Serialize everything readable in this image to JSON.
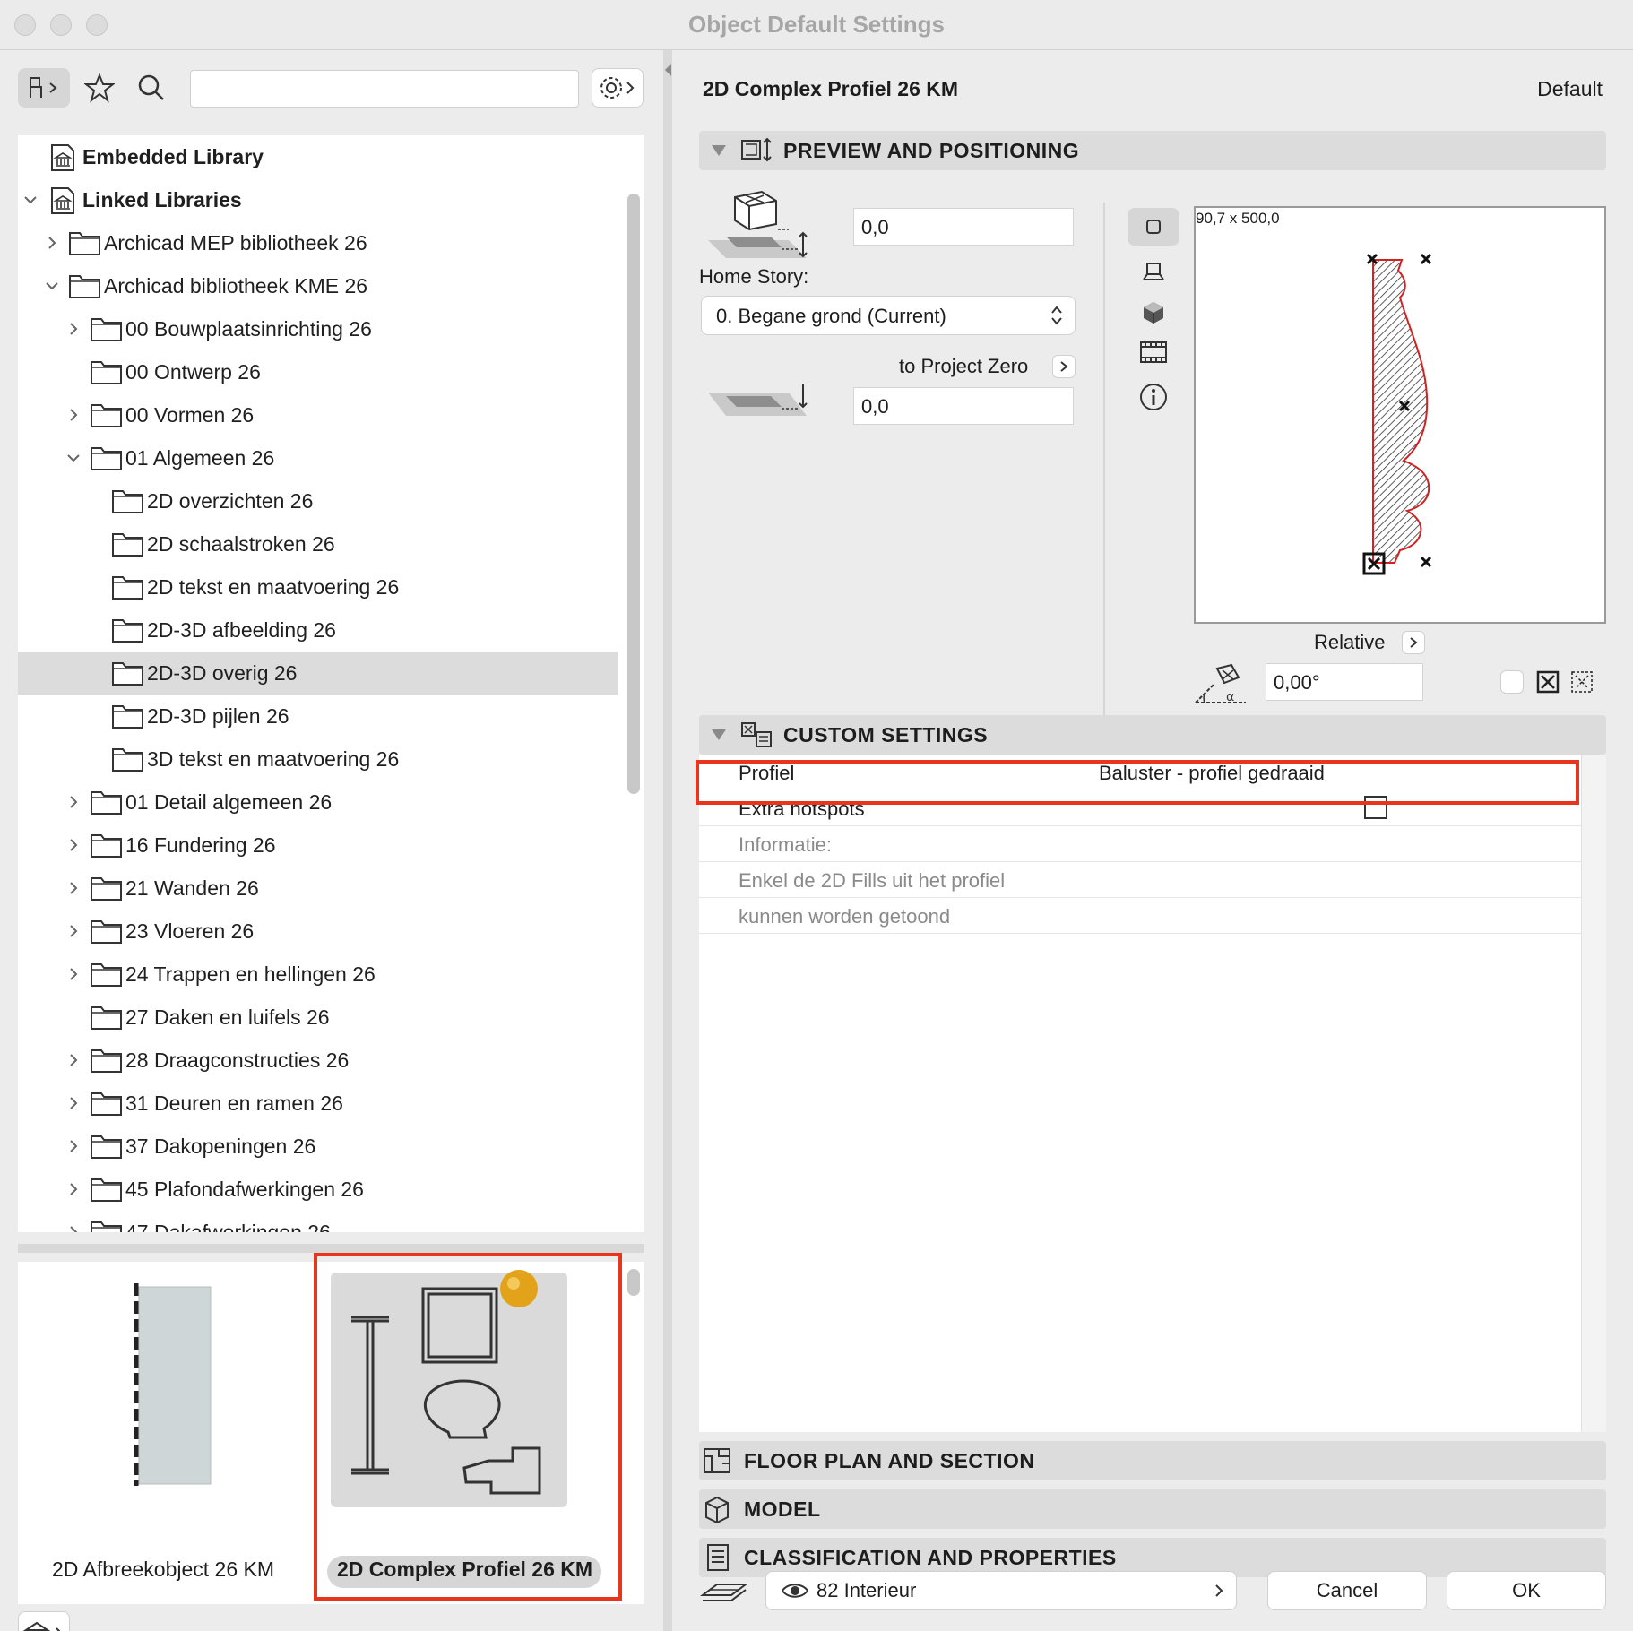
{
  "window": {
    "title": "Object Default Settings"
  },
  "left": {
    "search": {
      "placeholder": ""
    },
    "tree": [
      {
        "label": "Embedded Library",
        "bold": true,
        "level": 0,
        "expander": "none",
        "icon": "library-icon"
      },
      {
        "label": "Linked Libraries",
        "bold": true,
        "level": 0,
        "expander": "open",
        "icon": "library-icon"
      },
      {
        "label": "Archicad MEP bibliotheek 26",
        "level": 1,
        "expander": "closed",
        "icon": "folder-icon"
      },
      {
        "label": "Archicad bibliotheek KME 26",
        "level": 1,
        "expander": "open",
        "icon": "folder-icon"
      },
      {
        "label": "00 Bouwplaatsinrichting 26",
        "level": 2,
        "expander": "closed",
        "icon": "folder-icon"
      },
      {
        "label": "00 Ontwerp 26",
        "level": 2,
        "expander": "none",
        "icon": "folder-icon"
      },
      {
        "label": "00 Vormen 26",
        "level": 2,
        "expander": "closed",
        "icon": "folder-icon"
      },
      {
        "label": "01 Algemeen 26",
        "level": 2,
        "expander": "open",
        "icon": "folder-icon"
      },
      {
        "label": "2D overzichten 26",
        "level": 3,
        "expander": "none",
        "icon": "folder-icon"
      },
      {
        "label": "2D schaalstroken 26",
        "level": 3,
        "expander": "none",
        "icon": "folder-icon"
      },
      {
        "label": "2D tekst en maatvoering 26",
        "level": 3,
        "expander": "none",
        "icon": "folder-icon"
      },
      {
        "label": "2D-3D afbeelding 26",
        "level": 3,
        "expander": "none",
        "icon": "folder-icon"
      },
      {
        "label": "2D-3D overig 26",
        "level": 3,
        "expander": "none",
        "icon": "folder-icon",
        "selected": true
      },
      {
        "label": "2D-3D pijlen 26",
        "level": 3,
        "expander": "none",
        "icon": "folder-icon"
      },
      {
        "label": "3D tekst en maatvoering 26",
        "level": 3,
        "expander": "none",
        "icon": "folder-icon"
      },
      {
        "label": "01 Detail algemeen 26",
        "level": 2,
        "expander": "closed",
        "icon": "folder-icon"
      },
      {
        "label": "16 Fundering 26",
        "level": 2,
        "expander": "closed",
        "icon": "folder-icon"
      },
      {
        "label": "21 Wanden 26",
        "level": 2,
        "expander": "closed",
        "icon": "folder-icon"
      },
      {
        "label": "23 Vloeren 26",
        "level": 2,
        "expander": "closed",
        "icon": "folder-icon"
      },
      {
        "label": "24 Trappen en hellingen 26",
        "level": 2,
        "expander": "closed",
        "icon": "folder-icon"
      },
      {
        "label": "27 Daken en luifels 26",
        "level": 2,
        "expander": "none",
        "icon": "folder-icon"
      },
      {
        "label": "28 Draagconstructies 26",
        "level": 2,
        "expander": "closed",
        "icon": "folder-icon"
      },
      {
        "label": "31 Deuren en ramen 26",
        "level": 2,
        "expander": "closed",
        "icon": "folder-icon"
      },
      {
        "label": "37 Dakopeningen 26",
        "level": 2,
        "expander": "closed",
        "icon": "folder-icon"
      },
      {
        "label": "45 Plafondafwerkingen 26",
        "level": 2,
        "expander": "closed",
        "icon": "folder-icon"
      },
      {
        "label": "47 Dakafwerkingen 26",
        "level": 2,
        "expander": "closed",
        "icon": "folder-icon"
      }
    ],
    "objects": [
      {
        "label": "2D Afbreekobject 26 KM"
      },
      {
        "label": "2D Complex Profiel 26 KM",
        "selected": true
      }
    ]
  },
  "right": {
    "object_name": "2D Complex Profiel 26 KM",
    "default_label": "Default",
    "sections": {
      "preview": "PREVIEW AND POSITIONING",
      "custom": "CUSTOM SETTINGS",
      "floorplan": "FLOOR PLAN AND SECTION",
      "model": "MODEL",
      "classification": "CLASSIFICATION AND PROPERTIES"
    },
    "positioning": {
      "elevation_value": "0,0",
      "home_story_label": "Home Story:",
      "home_story_value": "0. Begane grond (Current)",
      "to_project_zero_label": "to Project Zero",
      "project_zero_value": "0,0",
      "preview_size": "90,7 x 500,0",
      "relative_label": "Relative",
      "angle_value": "0,00°"
    },
    "custom_settings": [
      {
        "key": "Profiel",
        "value": "Baluster - profiel gedraaid",
        "grey": false
      },
      {
        "key": "Extra hotspots",
        "value": "",
        "checkbox": true,
        "grey": false
      },
      {
        "key": "Informatie:",
        "value": "",
        "grey": true
      },
      {
        "key": "Enkel de 2D Fills uit het profiel",
        "value": "",
        "grey": true
      },
      {
        "key": "kunnen worden getoond",
        "value": "",
        "grey": true
      }
    ],
    "footer": {
      "layer_value": "82 Interieur",
      "cancel_label": "Cancel",
      "ok_label": "OK"
    }
  },
  "colors": {
    "highlight": "#e8351c",
    "profile_outline": "#d42020"
  }
}
